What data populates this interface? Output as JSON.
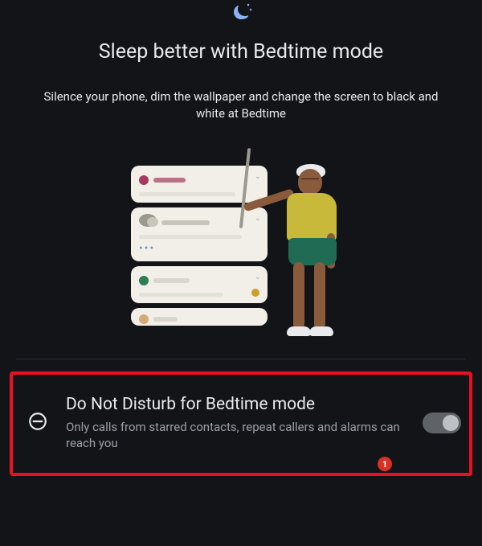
{
  "hero": {
    "title": "Sleep better with Bedtime mode",
    "subtitle": "Silence your phone, dim the wallpaper and change the screen to black and white at Bedtime"
  },
  "setting": {
    "title": "Do Not Disturb for Bedtime mode",
    "description": "Only calls from starred contacts, repeat callers and alarms can reach you",
    "switch_on": false
  },
  "badge": {
    "count": "1"
  },
  "icons": {
    "top": "moon-stars-icon",
    "dnd": "do-not-disturb-icon"
  },
  "colors": {
    "accent": "#8ab4f8",
    "highlight": "#e81123",
    "badge": "#d93025"
  }
}
